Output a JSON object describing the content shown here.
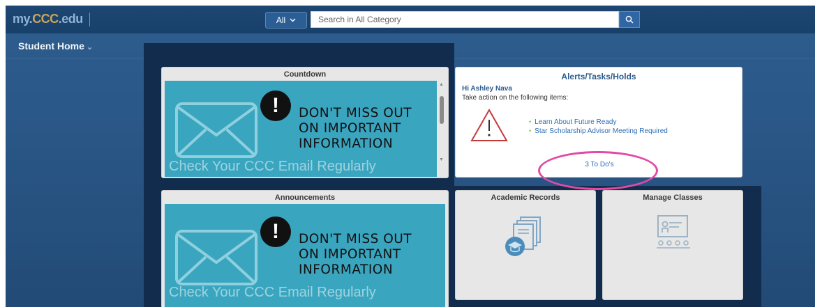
{
  "header": {
    "logo_main": "my.",
    "logo_accent": "CCC",
    "logo_tail": ".edu",
    "category_label": "All",
    "search_placeholder": "Search in All Category"
  },
  "page_title": "Student Home",
  "countdown": {
    "title": "Countdown",
    "msg_line1": "DON'T MISS OUT",
    "msg_line2": "ON IMPORTANT",
    "msg_line3": "INFORMATION",
    "footer": "Check Your CCC Email Regularly"
  },
  "announcements": {
    "title": "Announcements",
    "msg_line1": "DON'T MISS OUT",
    "msg_line2": "ON IMPORTANT",
    "msg_line3": "INFORMATION",
    "footer": "Check Your CCC Email Regularly"
  },
  "alerts": {
    "title": "Alerts/Tasks/Holds",
    "greeting": "Hi Ashley Nava",
    "instruction": "Take action on the following items:",
    "items": [
      "Learn About Future Ready",
      "Star Scholarship Advisor Meeting Required"
    ],
    "todo_link": "3 To Do's"
  },
  "tiles": {
    "academic_records": "Academic Records",
    "manage_classes": "Manage Classes"
  },
  "colors": {
    "background": "#2a5787",
    "promo": "#3aa5bf",
    "link": "#2f6db5",
    "highlight": "#e24aa5"
  }
}
